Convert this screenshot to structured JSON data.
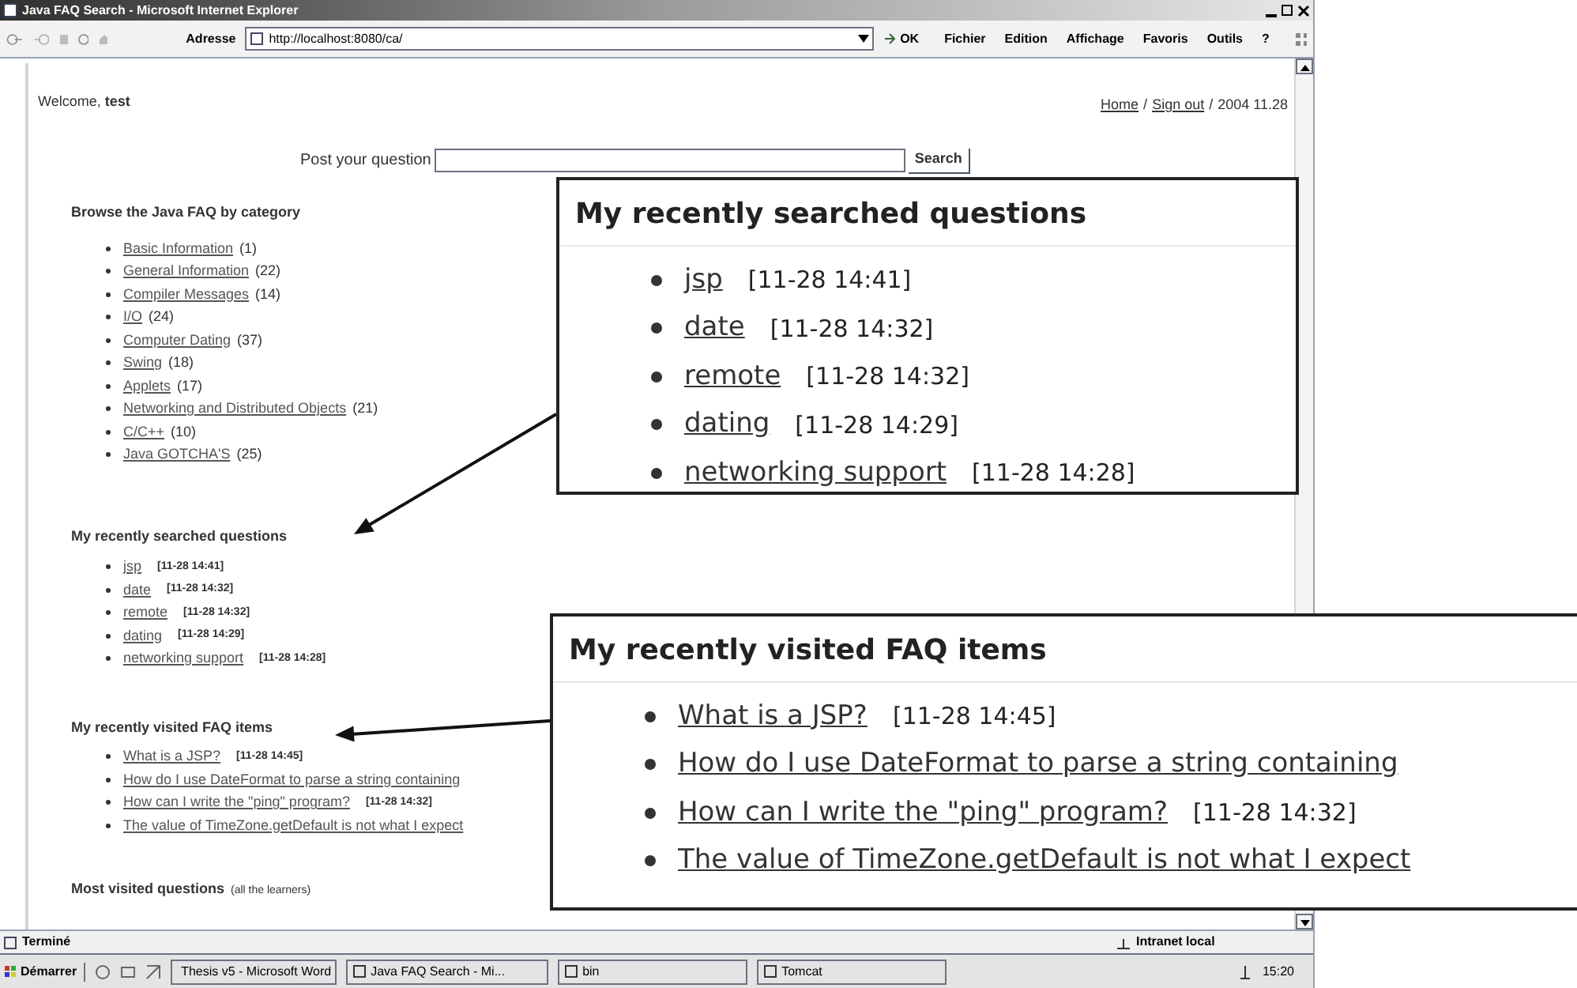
{
  "window": {
    "title": "Java FAQ Search - Microsoft Internet Explorer"
  },
  "toolbar": {
    "address_label": "Adresse",
    "address": "http://localhost:8080/ca/",
    "go": "OK",
    "menus": [
      "Fichier",
      "Edition",
      "Affichage",
      "Favoris",
      "Outils",
      "?"
    ]
  },
  "page": {
    "welcome": "Welcome, **test**",
    "top_links": [
      "Home",
      "Sign out"
    ],
    "separator": "/",
    "date": "2004 11.28",
    "search": {
      "label": "Post your question",
      "button": "Search"
    },
    "categories": {
      "title": "Browse the Java FAQ by category",
      "items": [
        {
          "label": "Basic Information",
          "count": "(1)"
        },
        {
          "label": "General Information",
          "count": "(22)"
        },
        {
          "label": "Compiler Messages",
          "count": "(14)"
        },
        {
          "label": "I/O",
          "count": "(24)"
        },
        {
          "label": "Computer Dating",
          "count": "(37)"
        },
        {
          "label": "Swing",
          "count": "(18)"
        },
        {
          "label": "Applets",
          "count": "(17)"
        },
        {
          "label": "Networking and Distributed Objects",
          "count": "(21)"
        },
        {
          "label": "C/C++",
          "count": "(10)"
        },
        {
          "label": "Java GOTCHA'S",
          "count": "(25)"
        }
      ]
    },
    "searched": {
      "title": "My recently searched questions",
      "items": [
        {
          "label": "jsp",
          "time": "[11-28 14:41]"
        },
        {
          "label": "date",
          "time": "[11-28 14:32]"
        },
        {
          "label": "remote",
          "time": "[11-28 14:32]"
        },
        {
          "label": "dating",
          "time": "[11-28 14:29]"
        },
        {
          "label": "networking support",
          "time": "[11-28 14:28]"
        }
      ]
    },
    "visited": {
      "title": "My recently visited FAQ items",
      "items": [
        {
          "label": "What is a JSP?",
          "time": "[11-28 14:45]"
        },
        {
          "label": "How do I use DateFormat to parse a string containing"
        },
        {
          "label": "How can I write the \"ping\" program?",
          "time": "[11-28 14:32]"
        },
        {
          "label": "The value of TimeZone.getDefault is not what I expect"
        }
      ]
    },
    "most_visited": {
      "title": "Most visited questions",
      "note": "(all the learners)"
    }
  },
  "callouts": [
    {
      "title": "My recently searched questions",
      "items": [
        {
          "label": "jsp",
          "time": "[11-28 14:41]"
        },
        {
          "label": "date",
          "time": "[11-28 14:32]"
        },
        {
          "label": "remote",
          "time": "[11-28 14:32]"
        },
        {
          "label": "dating",
          "time": "[11-28 14:29]"
        },
        {
          "label": "networking support",
          "time": "[11-28 14:28]"
        }
      ]
    },
    {
      "title": "My recently visited FAQ items",
      "items": [
        {
          "label": "What is a JSP?",
          "time": "[11-28 14:45]"
        },
        {
          "label": "How do I use DateFormat to parse a string containing"
        },
        {
          "label": "How can I write the \"ping\" program?",
          "time": "[11-28 14:32]"
        },
        {
          "label": "The value of TimeZone.getDefault is not what I expect"
        }
      ]
    }
  ],
  "status_bar": {
    "status": "Terminé",
    "zone": "Intranet local"
  },
  "taskbar": {
    "start": "Démarrer",
    "tasks": [
      "Thesis v5 - Microsoft Word",
      "Java FAQ Search - Mi...",
      "bin",
      "Tomcat"
    ],
    "clock": "15:20"
  }
}
